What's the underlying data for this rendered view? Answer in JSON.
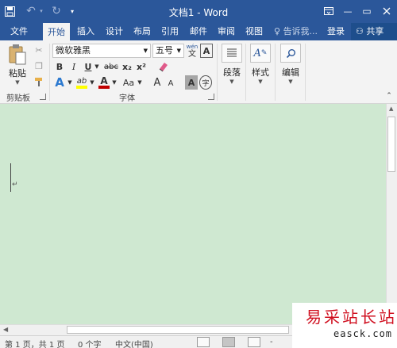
{
  "window": {
    "title": "文档1 - Word",
    "minimize_glyph": "—",
    "restore_glyph": "▭"
  },
  "tabs": [
    {
      "label": "文件"
    },
    {
      "label": "开始",
      "active": true
    },
    {
      "label": "插入"
    },
    {
      "label": "设计"
    },
    {
      "label": "布局"
    },
    {
      "label": "引用"
    },
    {
      "label": "邮件"
    },
    {
      "label": "审阅"
    },
    {
      "label": "视图"
    }
  ],
  "tell_me": "告诉我...",
  "sign_in": "登录",
  "share": "共享",
  "ribbon": {
    "clipboard": {
      "paste": "粘贴",
      "group": "剪贴板"
    },
    "font": {
      "font_name": "微软雅黑",
      "font_size": "五号",
      "group": "字体",
      "bold": "B",
      "italic": "I",
      "underline": "U",
      "strike": "abc",
      "subscript": "x₂",
      "superscript": "x²",
      "font_color_letter": "A",
      "case_label": "Aa",
      "grow": "A",
      "shrink": "A",
      "char_shading": "A",
      "enclose": "字",
      "phonetic_top": "wén",
      "phonetic_bottom": "文",
      "border_letter": "A",
      "highlight": "ab"
    },
    "paragraph": {
      "label": "段落"
    },
    "styles": {
      "label": "样式"
    },
    "editing": {
      "label": "编辑"
    }
  },
  "status": {
    "page": "第 1 页，共 1 页",
    "words": "0 个字",
    "language": "中文(中国)",
    "zoom_minus": "-"
  },
  "watermark": {
    "cn": "易采站长站",
    "en": "easck.com"
  },
  "colors": {
    "title_bar": "#2b579a",
    "ribbon_bg": "#f3f3f3",
    "document_bg": "#cfe8d1",
    "font_color": "#c00000",
    "highlight": "#ffff00",
    "watermark_red": "#d01020"
  }
}
